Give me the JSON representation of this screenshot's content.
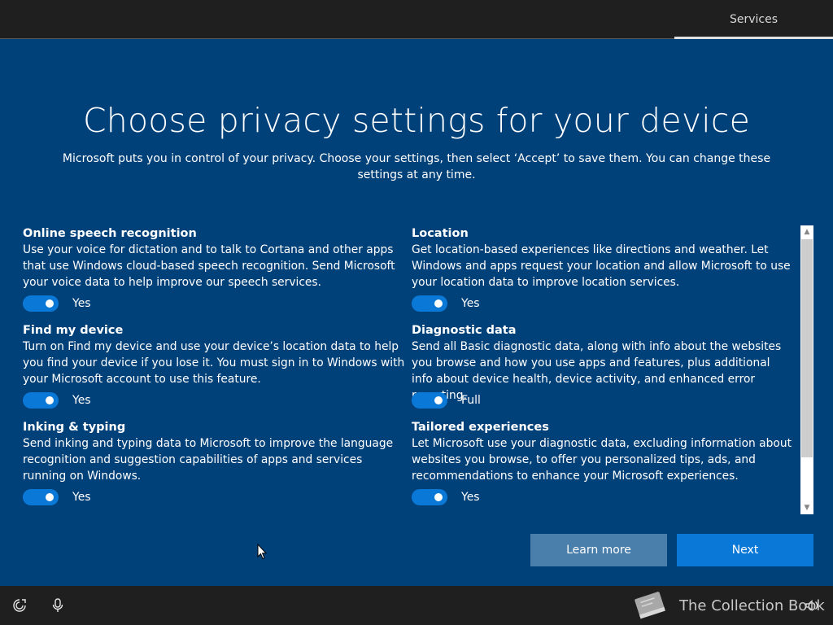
{
  "topbar": {
    "tab_label": "Services"
  },
  "page": {
    "title": "Choose privacy settings for your device",
    "subtitle": "Microsoft puts you in control of your privacy. Choose your settings, then select ‘Accept’ to save them. You can change these settings at any time."
  },
  "settings": {
    "left": [
      {
        "title": "Online speech recognition",
        "description": "Use your voice for dictation and to talk to Cortana and other apps that use Windows cloud-based speech recognition. Send Microsoft your voice data to help improve our speech services.",
        "toggle_state": "on",
        "value": "Yes"
      },
      {
        "title": "Find my device",
        "description": "Turn on Find my device and use your device’s location data to help you find your device if you lose it. You must sign in to Windows with your Microsoft account to use this feature.",
        "toggle_state": "on",
        "value": "Yes"
      },
      {
        "title": "Inking & typing",
        "description": "Send inking and typing data to Microsoft to improve the language recognition and suggestion capabilities of apps and services running on Windows.",
        "toggle_state": "on",
        "value": "Yes"
      }
    ],
    "right": [
      {
        "title": "Location",
        "description": "Get location-based experiences like directions and weather. Let Windows and apps request your location and allow Microsoft to use your location data to improve location services.",
        "toggle_state": "on",
        "value": "Yes"
      },
      {
        "title": "Diagnostic data",
        "description": "Send all Basic diagnostic data, along with info about the websites you browse and how you use apps and features, plus additional info about device health, device activity, and enhanced error reporting.",
        "toggle_state": "on",
        "value": "Full"
      },
      {
        "title": "Tailored experiences",
        "description": "Let Microsoft use your diagnostic data, excluding information about websites you browse, to offer you personalized tips, ads, and recommendations to enhance your Microsoft experiences.",
        "toggle_state": "on",
        "value": "Yes"
      }
    ]
  },
  "buttons": {
    "learn_more": "Learn more",
    "next": "Next"
  },
  "bottombar": {
    "icons": [
      "ease-of-access-icon",
      "microphone-icon",
      "volume-icon"
    ],
    "watermark_text": "The Collection Book"
  },
  "colors": {
    "background": "#00417a",
    "accent": "#0a78d7",
    "bar": "#1f1f1f"
  }
}
